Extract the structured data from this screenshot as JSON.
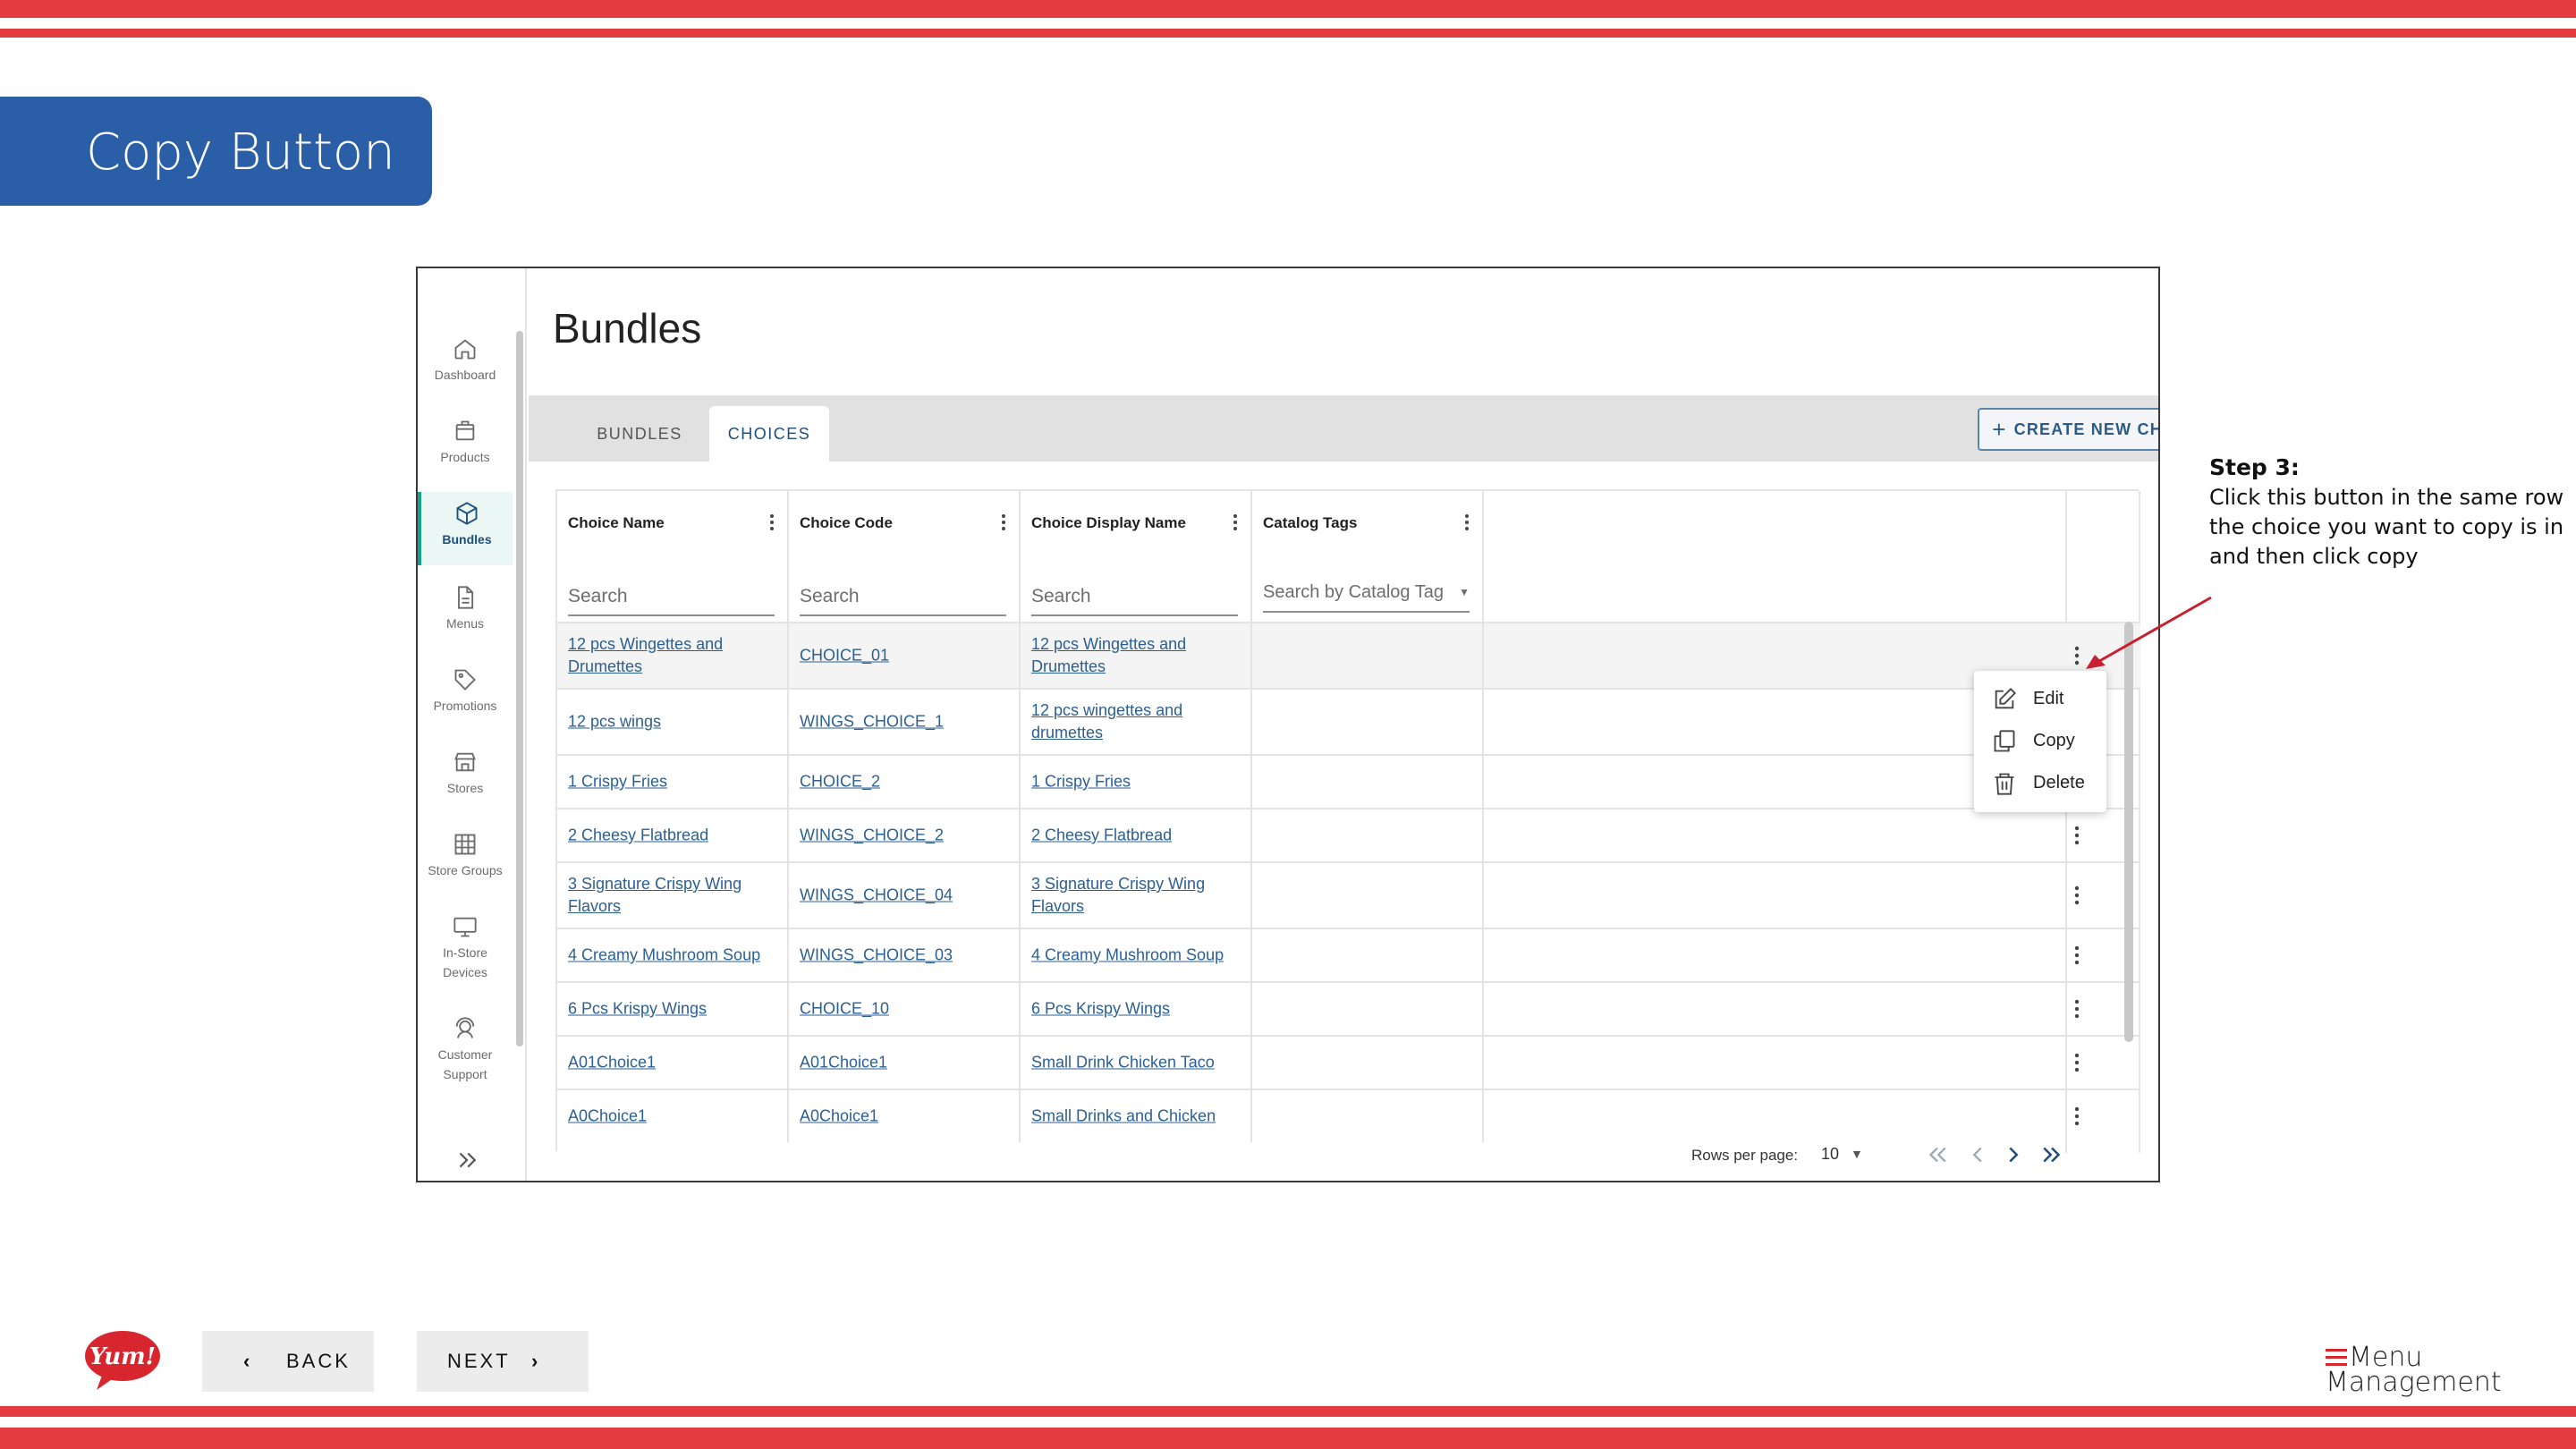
{
  "slide": {
    "title": "Copy Button",
    "accent_color": "#e33b3f",
    "title_bg_color": "#2a5fa7"
  },
  "sidebar": {
    "items": [
      {
        "label": "Dashboard",
        "icon": "home-icon"
      },
      {
        "label": "Products",
        "icon": "box-icon"
      },
      {
        "label": "Bundles",
        "icon": "cube-icon",
        "active": true
      },
      {
        "label": "Menus",
        "icon": "document-icon"
      },
      {
        "label": "Promotions",
        "icon": "tag-icon"
      },
      {
        "label": "Stores",
        "icon": "store-icon"
      },
      {
        "label": "Store Groups",
        "icon": "grid-icon"
      },
      {
        "label": "In-Store Devices",
        "icon": "monitor-icon"
      },
      {
        "label": "Customer Support",
        "icon": "headset-icon"
      }
    ],
    "expand_icon": "double-chevron-right-icon"
  },
  "page": {
    "title": "Bundles",
    "tabs": [
      {
        "label": "BUNDLES",
        "active": false
      },
      {
        "label": "CHOICES",
        "active": true
      }
    ],
    "create_button": "CREATE NEW CHOICE"
  },
  "table": {
    "columns": [
      "Choice Name",
      "Choice Code",
      "Choice Display Name",
      "Catalog Tags"
    ],
    "filters": [
      "Search",
      "Search",
      "Search",
      "Search by Catalog Tag"
    ],
    "rows": [
      {
        "name": "12 pcs Wingettes and Drumettes",
        "code": "CHOICE_01",
        "display": "12 pcs Wingettes and Drumettes"
      },
      {
        "name": "12 pcs wings",
        "code": "WINGS_CHOICE_1",
        "display": "12 pcs wingettes and drumettes"
      },
      {
        "name": "1 Crispy Fries",
        "code": "CHOICE_2",
        "display": "1 Crispy Fries"
      },
      {
        "name": "2 Cheesy Flatbread",
        "code": "WINGS_CHOICE_2",
        "display": "2 Cheesy Flatbread"
      },
      {
        "name": "3 Signature Crispy Wing Flavors",
        "code": "WINGS_CHOICE_04",
        "display": "3 Signature Crispy Wing Flavors"
      },
      {
        "name": "4 Creamy Mushroom Soup",
        "code": "WINGS_CHOICE_03",
        "display": "4 Creamy Mushroom Soup"
      },
      {
        "name": "6 Pcs Krispy Wings",
        "code": "CHOICE_10",
        "display": "6 Pcs Krispy Wings"
      },
      {
        "name": "A01Choice1",
        "code": "A01Choice1",
        "display": "Small Drink Chicken Taco"
      },
      {
        "name": "A0Choice1",
        "code": "A0Choice1",
        "display": "Small Drinks and Chicken"
      }
    ],
    "context_menu": [
      "Edit",
      "Copy",
      "Delete"
    ]
  },
  "pagination": {
    "rows_per_page_label": "Rows per page:",
    "rows_per_page_value": "10"
  },
  "instructions": {
    "step_title": "Step 3:",
    "step_body": "Click this  button in the same row the choice you want to copy is in and then click copy"
  },
  "footer": {
    "back_label": "BACK",
    "next_label": "NEXT",
    "yum_logo_text": "Yum!",
    "brand_line1": "Menu",
    "brand_line2": "Management"
  }
}
